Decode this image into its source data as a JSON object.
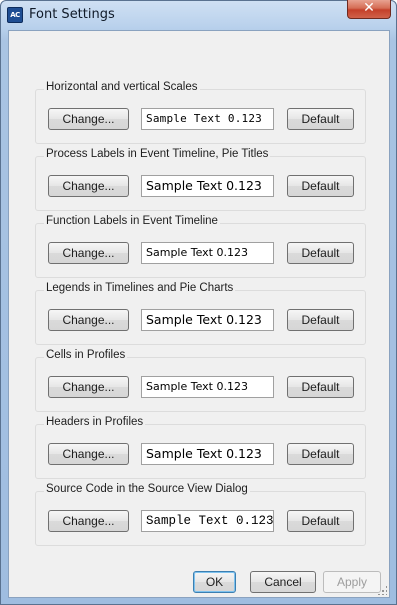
{
  "window": {
    "title": "Font Settings",
    "app_icon_text": "AC",
    "close_glyph": "✕"
  },
  "groups": [
    {
      "label": "Horizontal and vertical Scales",
      "change_label": "Change...",
      "sample_text": "Sample Text 0.123",
      "default_label": "Default"
    },
    {
      "label": "Process Labels in Event Timeline, Pie Titles",
      "change_label": "Change...",
      "sample_text": "Sample Text 0.123",
      "default_label": "Default"
    },
    {
      "label": "Function Labels in Event Timeline",
      "change_label": "Change...",
      "sample_text": "Sample Text 0.123",
      "default_label": "Default"
    },
    {
      "label": "Legends in Timelines and Pie Charts",
      "change_label": "Change...",
      "sample_text": "Sample Text 0.123",
      "default_label": "Default"
    },
    {
      "label": "Cells in Profiles",
      "change_label": "Change...",
      "sample_text": "Sample Text 0.123",
      "default_label": "Default"
    },
    {
      "label": "Headers in Profiles",
      "change_label": "Change...",
      "sample_text": "Sample Text 0.123",
      "default_label": "Default"
    },
    {
      "label": "Source Code in the Source View Dialog",
      "change_label": "Change...",
      "sample_text": "Sample Text 0.123",
      "default_label": "Default"
    }
  ],
  "footer": {
    "ok_label": "OK",
    "cancel_label": "Cancel",
    "apply_label": "Apply"
  },
  "colors": {
    "title_bar": "#b9d1ec",
    "close_button": "#c4402a",
    "dialog_bg": "#f0f0f0"
  }
}
